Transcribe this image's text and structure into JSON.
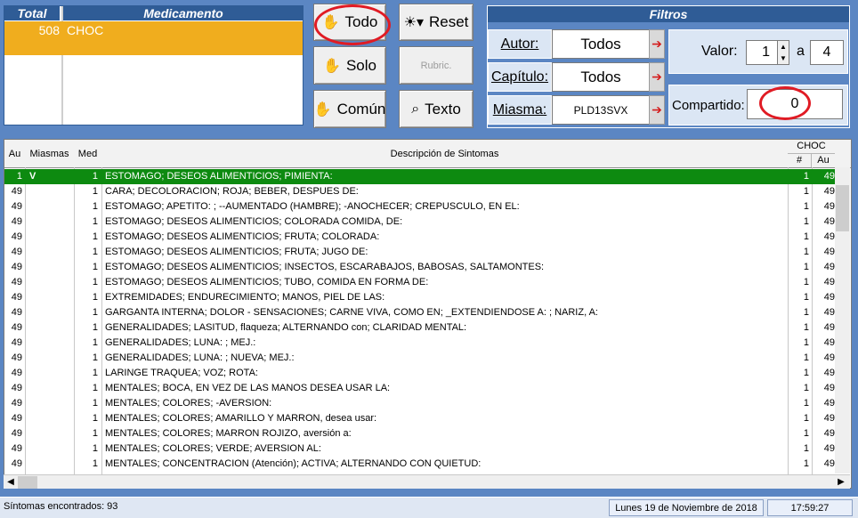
{
  "med_list": {
    "header_total": "Total",
    "header_med": "Medicamento",
    "rows": [
      {
        "total": "508",
        "name": "CHOC"
      }
    ]
  },
  "buttons": {
    "todo": "Todo",
    "solo": "Solo",
    "comun": "Común",
    "reset": "Reset",
    "rubric": "Rubric.",
    "texto": "Texto"
  },
  "filtros": {
    "title": "Filtros",
    "autor_label": "Autor:",
    "autor_value": "Todos",
    "capitulo_label": "Capítulo:",
    "capitulo_value": "Todos",
    "miasma_label": "Miasma:",
    "miasma_value": "PLD13SVX",
    "valor_label": "Valor:",
    "valor_from": "1",
    "valor_sep": "a",
    "valor_to": "4",
    "compartido_label": "Compartido:",
    "compartido_value": "0"
  },
  "table": {
    "headers": {
      "au": "Au",
      "miasmas": "Miasmas",
      "med": "Med",
      "descripcion": "Descripción de Sintomas",
      "choc": "CHOC",
      "choc_num": "#",
      "choc_au": "Au"
    },
    "rows": [
      {
        "au": "1",
        "miasmas": "V",
        "med": "1",
        "desc": "ESTOMAGO; DESEOS ALIMENTICIOS; PIMIENTA:",
        "n": "1",
        "au2": "49"
      },
      {
        "au": "49",
        "miasmas": "",
        "med": "1",
        "desc": "CARA; DECOLORACION; ROJA; BEBER, DESPUES DE:",
        "n": "1",
        "au2": "49"
      },
      {
        "au": "49",
        "miasmas": "",
        "med": "1",
        "desc": "ESTOMAGO; APETITO:         ; --AUMENTADO (HAMBRE); -ANOCHECER; CREPUSCULO, EN EL:",
        "n": "1",
        "au2": "49"
      },
      {
        "au": "49",
        "miasmas": "",
        "med": "1",
        "desc": "ESTOMAGO; DESEOS ALIMENTICIOS; COLORADA COMIDA, DE:",
        "n": "1",
        "au2": "49"
      },
      {
        "au": "49",
        "miasmas": "",
        "med": "1",
        "desc": "ESTOMAGO; DESEOS ALIMENTICIOS; FRUTA; COLORADA:",
        "n": "1",
        "au2": "49"
      },
      {
        "au": "49",
        "miasmas": "",
        "med": "1",
        "desc": "ESTOMAGO; DESEOS ALIMENTICIOS; FRUTA; JUGO DE:",
        "n": "1",
        "au2": "49"
      },
      {
        "au": "49",
        "miasmas": "",
        "med": "1",
        "desc": "ESTOMAGO; DESEOS ALIMENTICIOS; INSECTOS, ESCARABAJOS, BABOSAS, SALTAMONTES:",
        "n": "1",
        "au2": "49"
      },
      {
        "au": "49",
        "miasmas": "",
        "med": "1",
        "desc": "ESTOMAGO; DESEOS ALIMENTICIOS; TUBO, COMIDA EN FORMA DE:",
        "n": "1",
        "au2": "49"
      },
      {
        "au": "49",
        "miasmas": "",
        "med": "1",
        "desc": "EXTREMIDADES; ENDURECIMIENTO; MANOS, PIEL DE LAS:",
        "n": "1",
        "au2": "49"
      },
      {
        "au": "49",
        "miasmas": "",
        "med": "1",
        "desc": "GARGANTA INTERNA; DOLOR - SENSACIONES; CARNE VIVA, COMO EN; _EXTENDIENDOSE A:           ; NARIZ, A:",
        "n": "1",
        "au2": "49"
      },
      {
        "au": "49",
        "miasmas": "",
        "med": "1",
        "desc": "GENERALIDADES; LASITUD, flaqueza; ALTERNANDO con; CLARIDAD MENTAL:",
        "n": "1",
        "au2": "49"
      },
      {
        "au": "49",
        "miasmas": "",
        "med": "1",
        "desc": "GENERALIDADES; LUNA:       ; MEJ.:",
        "n": "1",
        "au2": "49"
      },
      {
        "au": "49",
        "miasmas": "",
        "med": "1",
        "desc": "GENERALIDADES; LUNA:       ; NUEVA; MEJ.:",
        "n": "1",
        "au2": "49"
      },
      {
        "au": "49",
        "miasmas": "",
        "med": "1",
        "desc": "LARINGE TRAQUEA; VOZ; ROTA:",
        "n": "1",
        "au2": "49"
      },
      {
        "au": "49",
        "miasmas": "",
        "med": "1",
        "desc": "MENTALES; BOCA, EN VEZ DE LAS MANOS DESEA USAR LA:",
        "n": "1",
        "au2": "49"
      },
      {
        "au": "49",
        "miasmas": "",
        "med": "1",
        "desc": "MENTALES; COLORES; -AVERSION:",
        "n": "1",
        "au2": "49"
      },
      {
        "au": "49",
        "miasmas": "",
        "med": "1",
        "desc": "MENTALES; COLORES; AMARILLO Y MARRON, desea usar:",
        "n": "1",
        "au2": "49"
      },
      {
        "au": "49",
        "miasmas": "",
        "med": "1",
        "desc": "MENTALES; COLORES; MARRON ROJIZO, aversión a:",
        "n": "1",
        "au2": "49"
      },
      {
        "au": "49",
        "miasmas": "",
        "med": "1",
        "desc": "MENTALES; COLORES; VERDE; AVERSION AL:",
        "n": "1",
        "au2": "49"
      },
      {
        "au": "49",
        "miasmas": "",
        "med": "1",
        "desc": "MENTALES; CONCENTRACION (Atención); ACTIVA; ALTERNANDO CON QUIETUD:",
        "n": "1",
        "au2": "49"
      }
    ]
  },
  "status": {
    "found": "Síntomas encontrados: 93",
    "date": "Lunes 19 de Noviembre de 2018",
    "time": "17:59:27"
  },
  "colors": {
    "selected_row": "#0d8a10",
    "med_highlight": "#f0ad1e",
    "header_blue": "#2f5c96",
    "circle_red": "#e01b24"
  }
}
